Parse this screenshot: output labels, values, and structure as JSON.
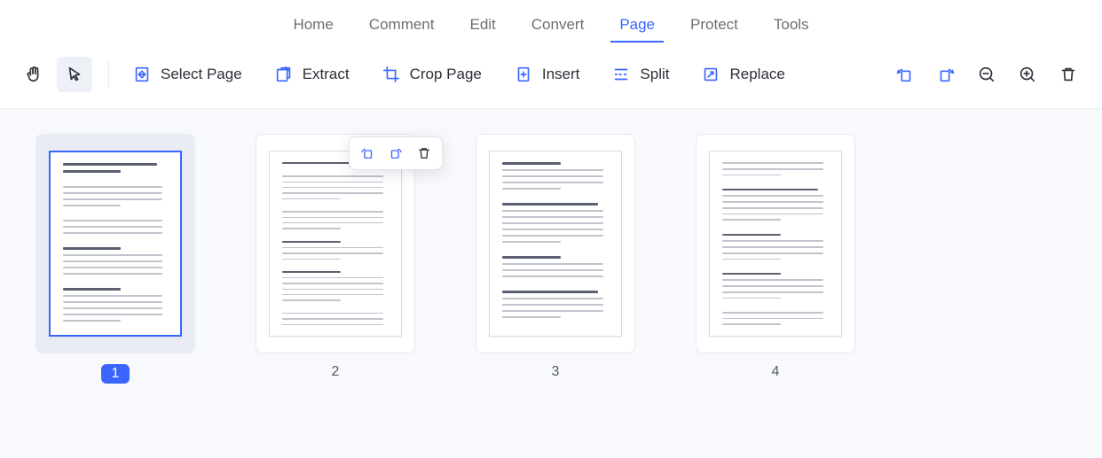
{
  "menu": {
    "tabs": [
      {
        "label": "Home"
      },
      {
        "label": "Comment"
      },
      {
        "label": "Edit"
      },
      {
        "label": "Convert"
      },
      {
        "label": "Page",
        "active": true
      },
      {
        "label": "Protect"
      },
      {
        "label": "Tools"
      }
    ]
  },
  "toolbar": {
    "hand_icon": "hand",
    "cursor_icon": "cursor",
    "select_page": "Select Page",
    "extract": "Extract",
    "crop_page": "Crop Page",
    "insert": "Insert",
    "split": "Split",
    "replace": "Replace",
    "rotate_left_icon": "rotate-left",
    "rotate_right_icon": "rotate-right",
    "zoom_out_icon": "zoom-out",
    "zoom_in_icon": "zoom-in",
    "delete_icon": "delete"
  },
  "pages": [
    {
      "number": "1",
      "selected": true
    },
    {
      "number": "2",
      "hover_tools": true
    },
    {
      "number": "3"
    },
    {
      "number": "4"
    }
  ],
  "hover_tools": {
    "rotate_left": "rotate-left",
    "rotate_right": "rotate-right",
    "delete": "delete"
  }
}
